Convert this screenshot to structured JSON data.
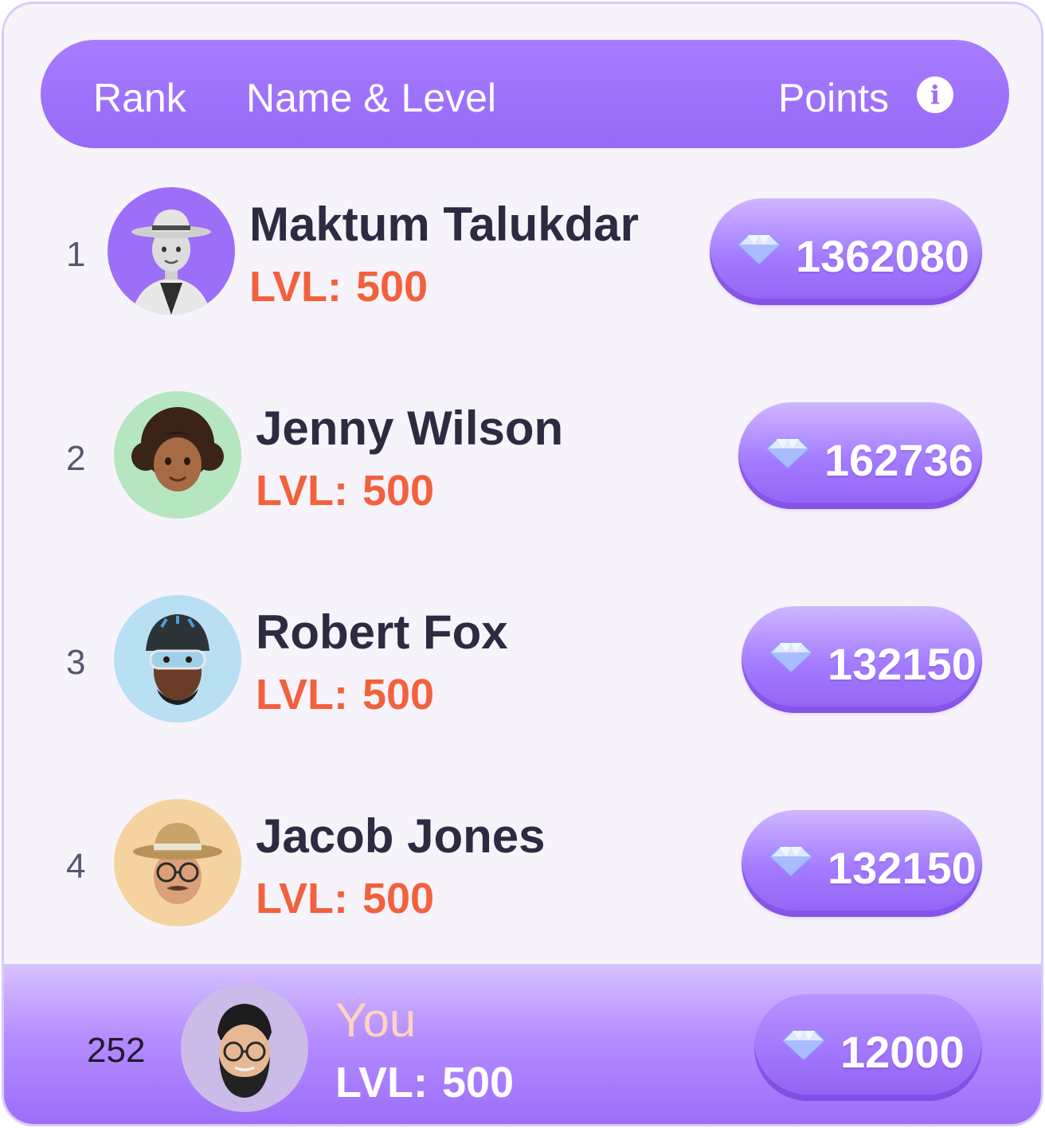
{
  "header": {
    "rank_label": "Rank",
    "name_level_label": "Name & Level",
    "points_label": "Points",
    "info_icon": "info-icon"
  },
  "rows": [
    {
      "rank": "1",
      "name": "Maktum Talukdar",
      "level_label": "LVL:",
      "level_value": "500",
      "points": "1362080",
      "avatar_bg": "#9b6ff8"
    },
    {
      "rank": "2",
      "name": "Jenny Wilson",
      "level_label": "LVL:",
      "level_value": "500",
      "points": "162736",
      "avatar_bg": "#b6e6c0"
    },
    {
      "rank": "3",
      "name": "Robert Fox",
      "level_label": "LVL:",
      "level_value": "500",
      "points": "132150",
      "avatar_bg": "#b9dff3"
    },
    {
      "rank": "4",
      "name": "Jacob Jones",
      "level_label": "LVL:",
      "level_value": "500",
      "points": "132150",
      "avatar_bg": "#f5d3a0"
    }
  ],
  "you": {
    "rank": "252",
    "name": "You",
    "level_label": "LVL:",
    "level_value": "500",
    "points": "12000",
    "avatar_bg": "#cbbbe8"
  },
  "colors": {
    "accent": "#9a6ff8",
    "level": "#f2613d",
    "name": "#2e2a42",
    "card_bg": "#f7f3fb"
  },
  "icons": {
    "points": "diamond-icon"
  }
}
